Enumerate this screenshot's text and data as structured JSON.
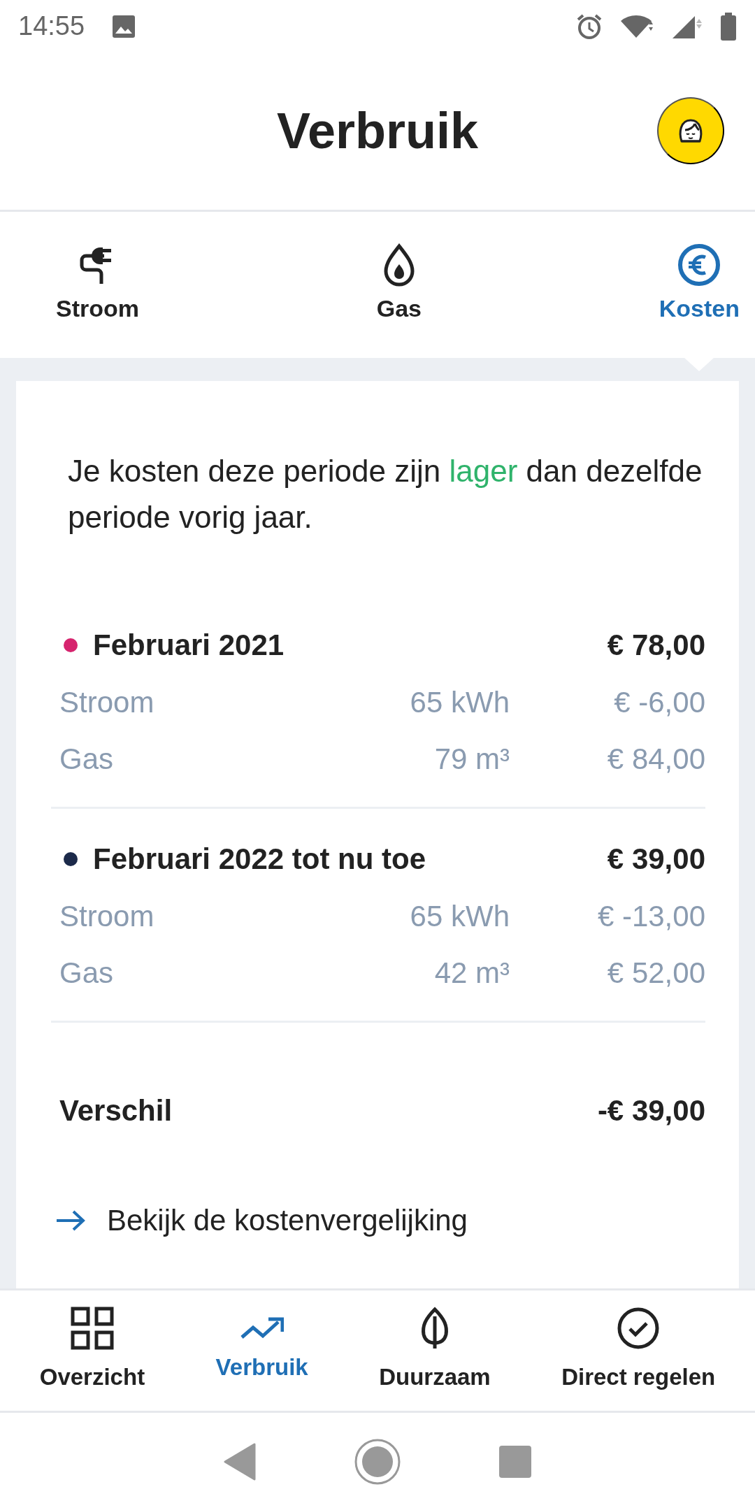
{
  "status_bar": {
    "time": "14:55"
  },
  "header": {
    "title": "Verbruik"
  },
  "tabs": [
    {
      "label": "Stroom",
      "selected": false
    },
    {
      "label": "Gas",
      "selected": false
    },
    {
      "label": "Kosten",
      "selected": true
    }
  ],
  "comparison": {
    "text_before": "Je kosten deze periode zijn",
    "highlight": "lager",
    "text_after": "dan dezelfde periode vorig jaar."
  },
  "periods": [
    {
      "label": "Februari 2021",
      "color": "#d6246e",
      "total": "€ 78,00",
      "rows": [
        {
          "label": "Stroom",
          "usage": "65 kWh",
          "cost": "€ -6,00"
        },
        {
          "label": "Gas",
          "usage": "79 m³",
          "cost": "€ 84,00"
        }
      ]
    },
    {
      "label": "Februari 2022 tot nu toe",
      "color": "#1c2a4a",
      "total": "€ 39,00",
      "rows": [
        {
          "label": "Stroom",
          "usage": "65 kWh",
          "cost": "€ -13,00"
        },
        {
          "label": "Gas",
          "usage": "42 m³",
          "cost": "€ 52,00"
        }
      ]
    }
  ],
  "difference": {
    "label": "Verschil",
    "value": "-€ 39,00"
  },
  "link": {
    "label": "Bekijk de kostenvergelijking"
  },
  "bottom_nav": [
    {
      "label": "Overzicht",
      "selected": false
    },
    {
      "label": "Verbruik",
      "selected": true
    },
    {
      "label": "Duurzaam",
      "selected": false
    },
    {
      "label": "Direct regelen",
      "selected": false
    }
  ]
}
